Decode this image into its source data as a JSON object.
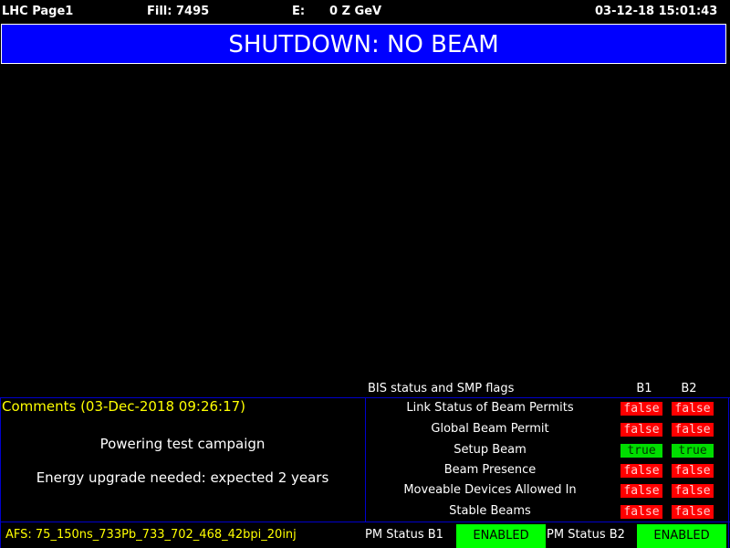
{
  "header": {
    "page": "LHC Page1",
    "fill": "Fill: 7495",
    "energy_label": "E:",
    "energy_value": "0 Z GeV",
    "datetime": "03-12-18 15:01:43"
  },
  "mode": {
    "text": "SHUTDOWN: NO BEAM",
    "color": "#0000ff"
  },
  "bis": {
    "title": "BIS status and SMP flags",
    "col_b1": "B1",
    "col_b2": "B2",
    "rows": [
      {
        "label": "Link Status of Beam Permits",
        "b1": "false",
        "b2": "false"
      },
      {
        "label": "Global Beam Permit",
        "b1": "false",
        "b2": "false"
      },
      {
        "label": "Setup Beam",
        "b1": "true",
        "b2": "true"
      },
      {
        "label": "Beam Presence",
        "b1": "false",
        "b2": "false"
      },
      {
        "label": "Moveable Devices Allowed In",
        "b1": "false",
        "b2": "false"
      },
      {
        "label": "Stable Beams",
        "b1": "false",
        "b2": "false"
      }
    ]
  },
  "comments": {
    "title": "Comments (03-Dec-2018 09:26:17)",
    "lines": [
      "Powering test campaign",
      "Energy upgrade needed: expected 2 years"
    ]
  },
  "footer": {
    "afs": "AFS: 75_150ns_733Pb_733_702_468_42bpi_20inj",
    "pm_b1_label": "PM Status B1",
    "pm_b1_value": "ENABLED",
    "pm_b2_label": "PM Status B2",
    "pm_b2_value": "ENABLED"
  },
  "colors": {
    "false": "#ff0000",
    "true": "#00dd00",
    "enabled": "#00ff00",
    "comments_title": "#ffff00"
  }
}
